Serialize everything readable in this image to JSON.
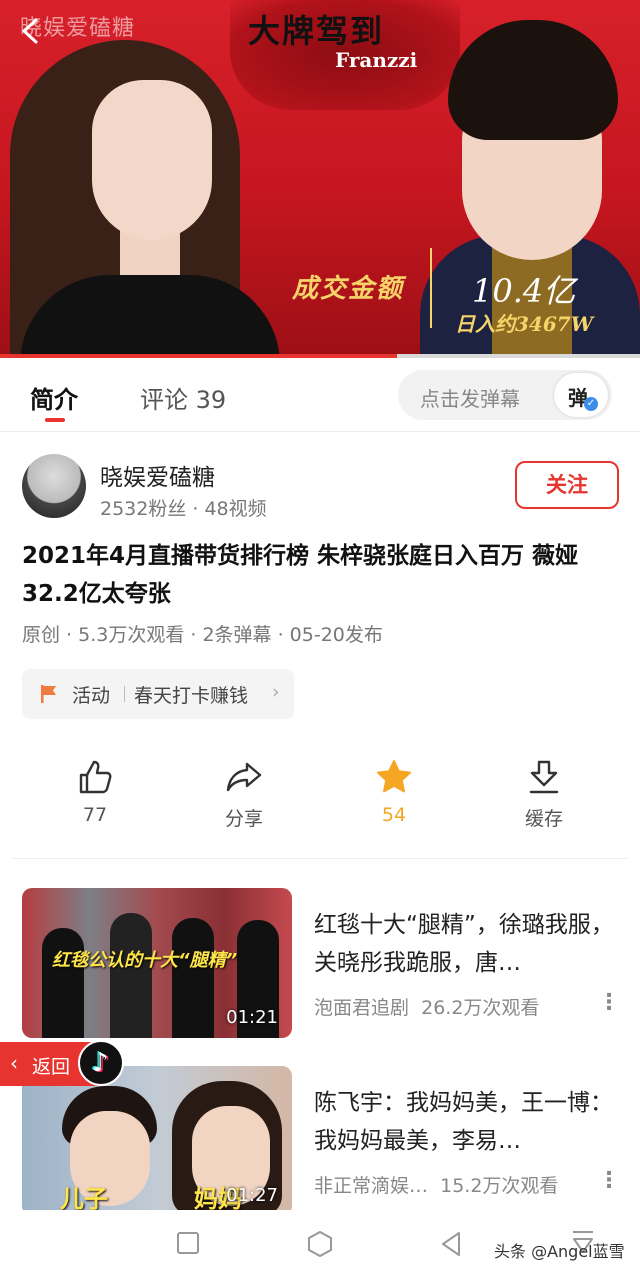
{
  "video": {
    "watermark": "晓娱爱磕糖",
    "banner_title": "大牌驾到",
    "brand": "Franzzi",
    "overlay_label": "成交金额",
    "overlay_amount": "10.4亿",
    "overlay_daily": "日入约3467W",
    "progress": 0.62
  },
  "tabs": {
    "intro": "简介",
    "comments": "评论 39",
    "danmu_placeholder": "点击发弹幕",
    "danmu_button": "弹"
  },
  "author": {
    "name": "晓娱爱磕糖",
    "stats": "2532粉丝 · 48视频",
    "follow": "关注"
  },
  "video_info": {
    "title": "2021年4月直播带货排行榜 朱梓骁张庭日入百万 薇娅32.2亿太夸张",
    "meta": "原创 · 5.3万次观看 · 2条弹幕 · 05-20发布"
  },
  "activity": {
    "label": "活动",
    "title": "春天打卡赚钱"
  },
  "actions": {
    "like_count": "77",
    "share_label": "分享",
    "favorite_count": "54",
    "download_label": "缓存"
  },
  "related": [
    {
      "title": "红毯十大“腿精”，徐璐我服，关晓彤我跪服，唐…",
      "channel": "泡面君追剧",
      "views": "26.2万次观看",
      "duration": "01:21",
      "caption": "红毯公认的十大“腿精”"
    },
    {
      "title": "陈飞宇：我妈妈美，王一博：我妈妈最美，李易…",
      "channel": "非正常滴娱…",
      "views": "15.2万次观看",
      "duration": "01:27",
      "label_left": "儿子",
      "label_right": "妈妈"
    }
  ],
  "floating": {
    "return_label": "返回"
  },
  "footer": {
    "source_mark": "头条 @Angel蓝雪"
  },
  "colors": {
    "accent": "#e7342e",
    "favorite": "#f5a623"
  }
}
